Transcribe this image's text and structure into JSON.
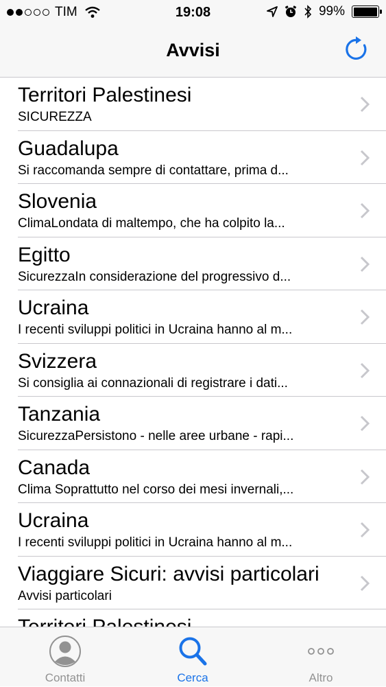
{
  "status": {
    "carrier": "TIM",
    "time": "19:08",
    "battery": "99%",
    "signal_bars_filled": 2,
    "signal_bars_total": 5
  },
  "nav": {
    "title": "Avvisi",
    "refresh_icon": "refresh-icon"
  },
  "items": [
    {
      "title": "Territori Palestinesi",
      "subtitle": "SICUREZZA"
    },
    {
      "title": "Guadalupa",
      "subtitle": "Si raccomanda sempre di contattare, prima d..."
    },
    {
      "title": "Slovenia",
      "subtitle": "ClimaLondata di maltempo, che ha colpito la..."
    },
    {
      "title": "Egitto",
      "subtitle": "SicurezzaIn considerazione del progressivo d..."
    },
    {
      "title": "Ucraina",
      "subtitle": "I recenti sviluppi politici in Ucraina hanno al m..."
    },
    {
      "title": "Svizzera",
      "subtitle": "Si consiglia ai connazionali di registrare i dati..."
    },
    {
      "title": "Tanzania",
      "subtitle": "SicurezzaPersistono - nelle aree urbane - rapi..."
    },
    {
      "title": "Canada",
      "subtitle": "Clima Soprattutto nel corso dei mesi invernali,..."
    },
    {
      "title": "Ucraina",
      "subtitle": "I recenti sviluppi politici in Ucraina hanno al m..."
    },
    {
      "title": "Viaggiare Sicuri: avvisi particolari",
      "subtitle": "Avvisi particolari"
    },
    {
      "title": "Territori Palestinesi",
      "subtitle": ""
    }
  ],
  "tabs": [
    {
      "label": "Contatti",
      "icon": "contact-icon",
      "active": false
    },
    {
      "label": "Cerca",
      "icon": "search-icon",
      "active": true
    },
    {
      "label": "Altro",
      "icon": "more-icon",
      "active": false
    }
  ],
  "colors": {
    "accent": "#1a73e8",
    "inactive": "#929292",
    "separator": "#c8c7cc",
    "bar_bg": "#f7f7f7"
  }
}
